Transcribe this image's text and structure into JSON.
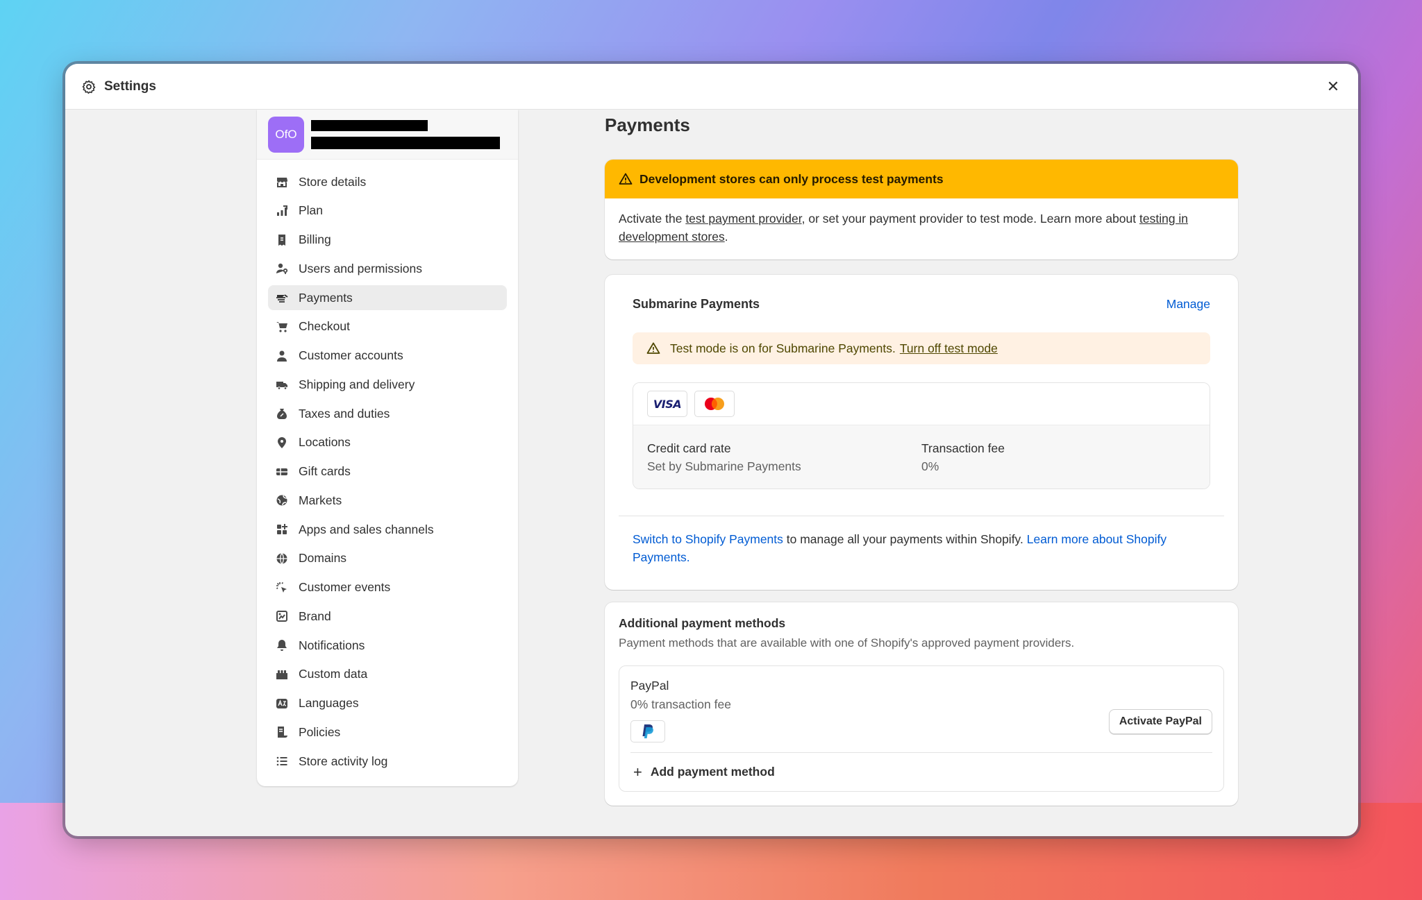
{
  "window": {
    "title": "Settings",
    "close_glyph": "✕"
  },
  "store": {
    "initials": "OfO"
  },
  "sidebar": {
    "items": [
      {
        "label": "Store details",
        "icon": "store-icon"
      },
      {
        "label": "Plan",
        "icon": "plan-icon"
      },
      {
        "label": "Billing",
        "icon": "billing-icon"
      },
      {
        "label": "Users and permissions",
        "icon": "users-icon"
      },
      {
        "label": "Payments",
        "icon": "payments-icon",
        "active": true
      },
      {
        "label": "Checkout",
        "icon": "cart-icon"
      },
      {
        "label": "Customer accounts",
        "icon": "person-icon"
      },
      {
        "label": "Shipping and delivery",
        "icon": "truck-icon"
      },
      {
        "label": "Taxes and duties",
        "icon": "tax-icon"
      },
      {
        "label": "Locations",
        "icon": "location-icon"
      },
      {
        "label": "Gift cards",
        "icon": "gift-card-icon"
      },
      {
        "label": "Markets",
        "icon": "globe-icon"
      },
      {
        "label": "Apps and sales channels",
        "icon": "apps-icon"
      },
      {
        "label": "Domains",
        "icon": "domain-globe-icon"
      },
      {
        "label": "Customer events",
        "icon": "cursor-icon"
      },
      {
        "label": "Brand",
        "icon": "brand-icon"
      },
      {
        "label": "Notifications",
        "icon": "bell-icon"
      },
      {
        "label": "Custom data",
        "icon": "custom-data-icon"
      },
      {
        "label": "Languages",
        "icon": "language-icon"
      },
      {
        "label": "Policies",
        "icon": "policies-icon"
      },
      {
        "label": "Store activity log",
        "icon": "list-icon"
      }
    ]
  },
  "main": {
    "title": "Payments",
    "banner": {
      "heading": "Development stores can only process test payments",
      "body_prefix": "Activate the ",
      "link1": "test payment provider",
      "body_mid": ", or set your payment provider to test mode. Learn more about ",
      "link2": "testing in development stores",
      "body_suffix": "."
    },
    "provider": {
      "name": "Submarine Payments",
      "manage": "Manage",
      "test_note": "Test mode is on for Submarine Payments.",
      "test_note_link": "Turn off test mode",
      "cards": [
        "VISA",
        "Mastercard"
      ],
      "rate_label": "Credit card rate",
      "rate_value": "Set by Submarine Payments",
      "fee_label": "Transaction fee",
      "fee_value": "0%",
      "switch_link": "Switch to Shopify Payments",
      "switch_text": " to manage all your payments within Shopify. ",
      "learn_link": "Learn more about Shopify Payments."
    },
    "additional": {
      "title": "Additional payment methods",
      "subtitle": "Payment methods that are available with one of Shopify's approved payment providers.",
      "paypal_name": "PayPal",
      "paypal_fee": "0% transaction fee",
      "activate": "Activate PayPal",
      "add_method": "Add payment method"
    }
  },
  "colors": {
    "accent_link": "#005bd3",
    "warning_banner": "#ffb800",
    "test_note_bg": "#fff1e3",
    "avatar": "#9d6ef6"
  }
}
